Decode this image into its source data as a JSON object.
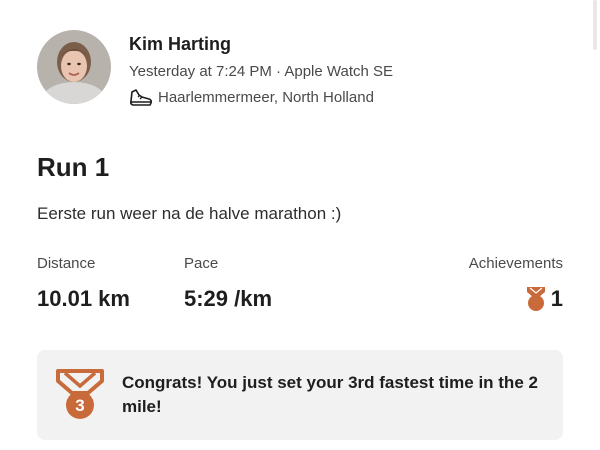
{
  "athlete": {
    "name": "Kim Harting",
    "meta": "Yesterday at 7:24 PM · Apple Watch SE",
    "location": "Haarlemmermeer, North Holland",
    "avatar_icon": "person-photo"
  },
  "activity": {
    "title": "Run 1",
    "description": "Eerste run weer na de halve marathon :)",
    "type_icon": "shoe-icon"
  },
  "stats": {
    "distance_label": "Distance",
    "distance_value": "10.01 km",
    "pace_label": "Pace",
    "pace_value": "5:29 /km",
    "achievements_label": "Achievements",
    "achievements_value": "1"
  },
  "banner": {
    "medal_rank": "3",
    "text": "Congrats! You just set your 3rd fastest time in the 2 mile!"
  },
  "colors": {
    "medal_bronze": "#c96a3b",
    "banner_bg": "#f2f2f2",
    "text_primary": "#1e1e1e",
    "text_secondary": "#4a4a4a"
  }
}
